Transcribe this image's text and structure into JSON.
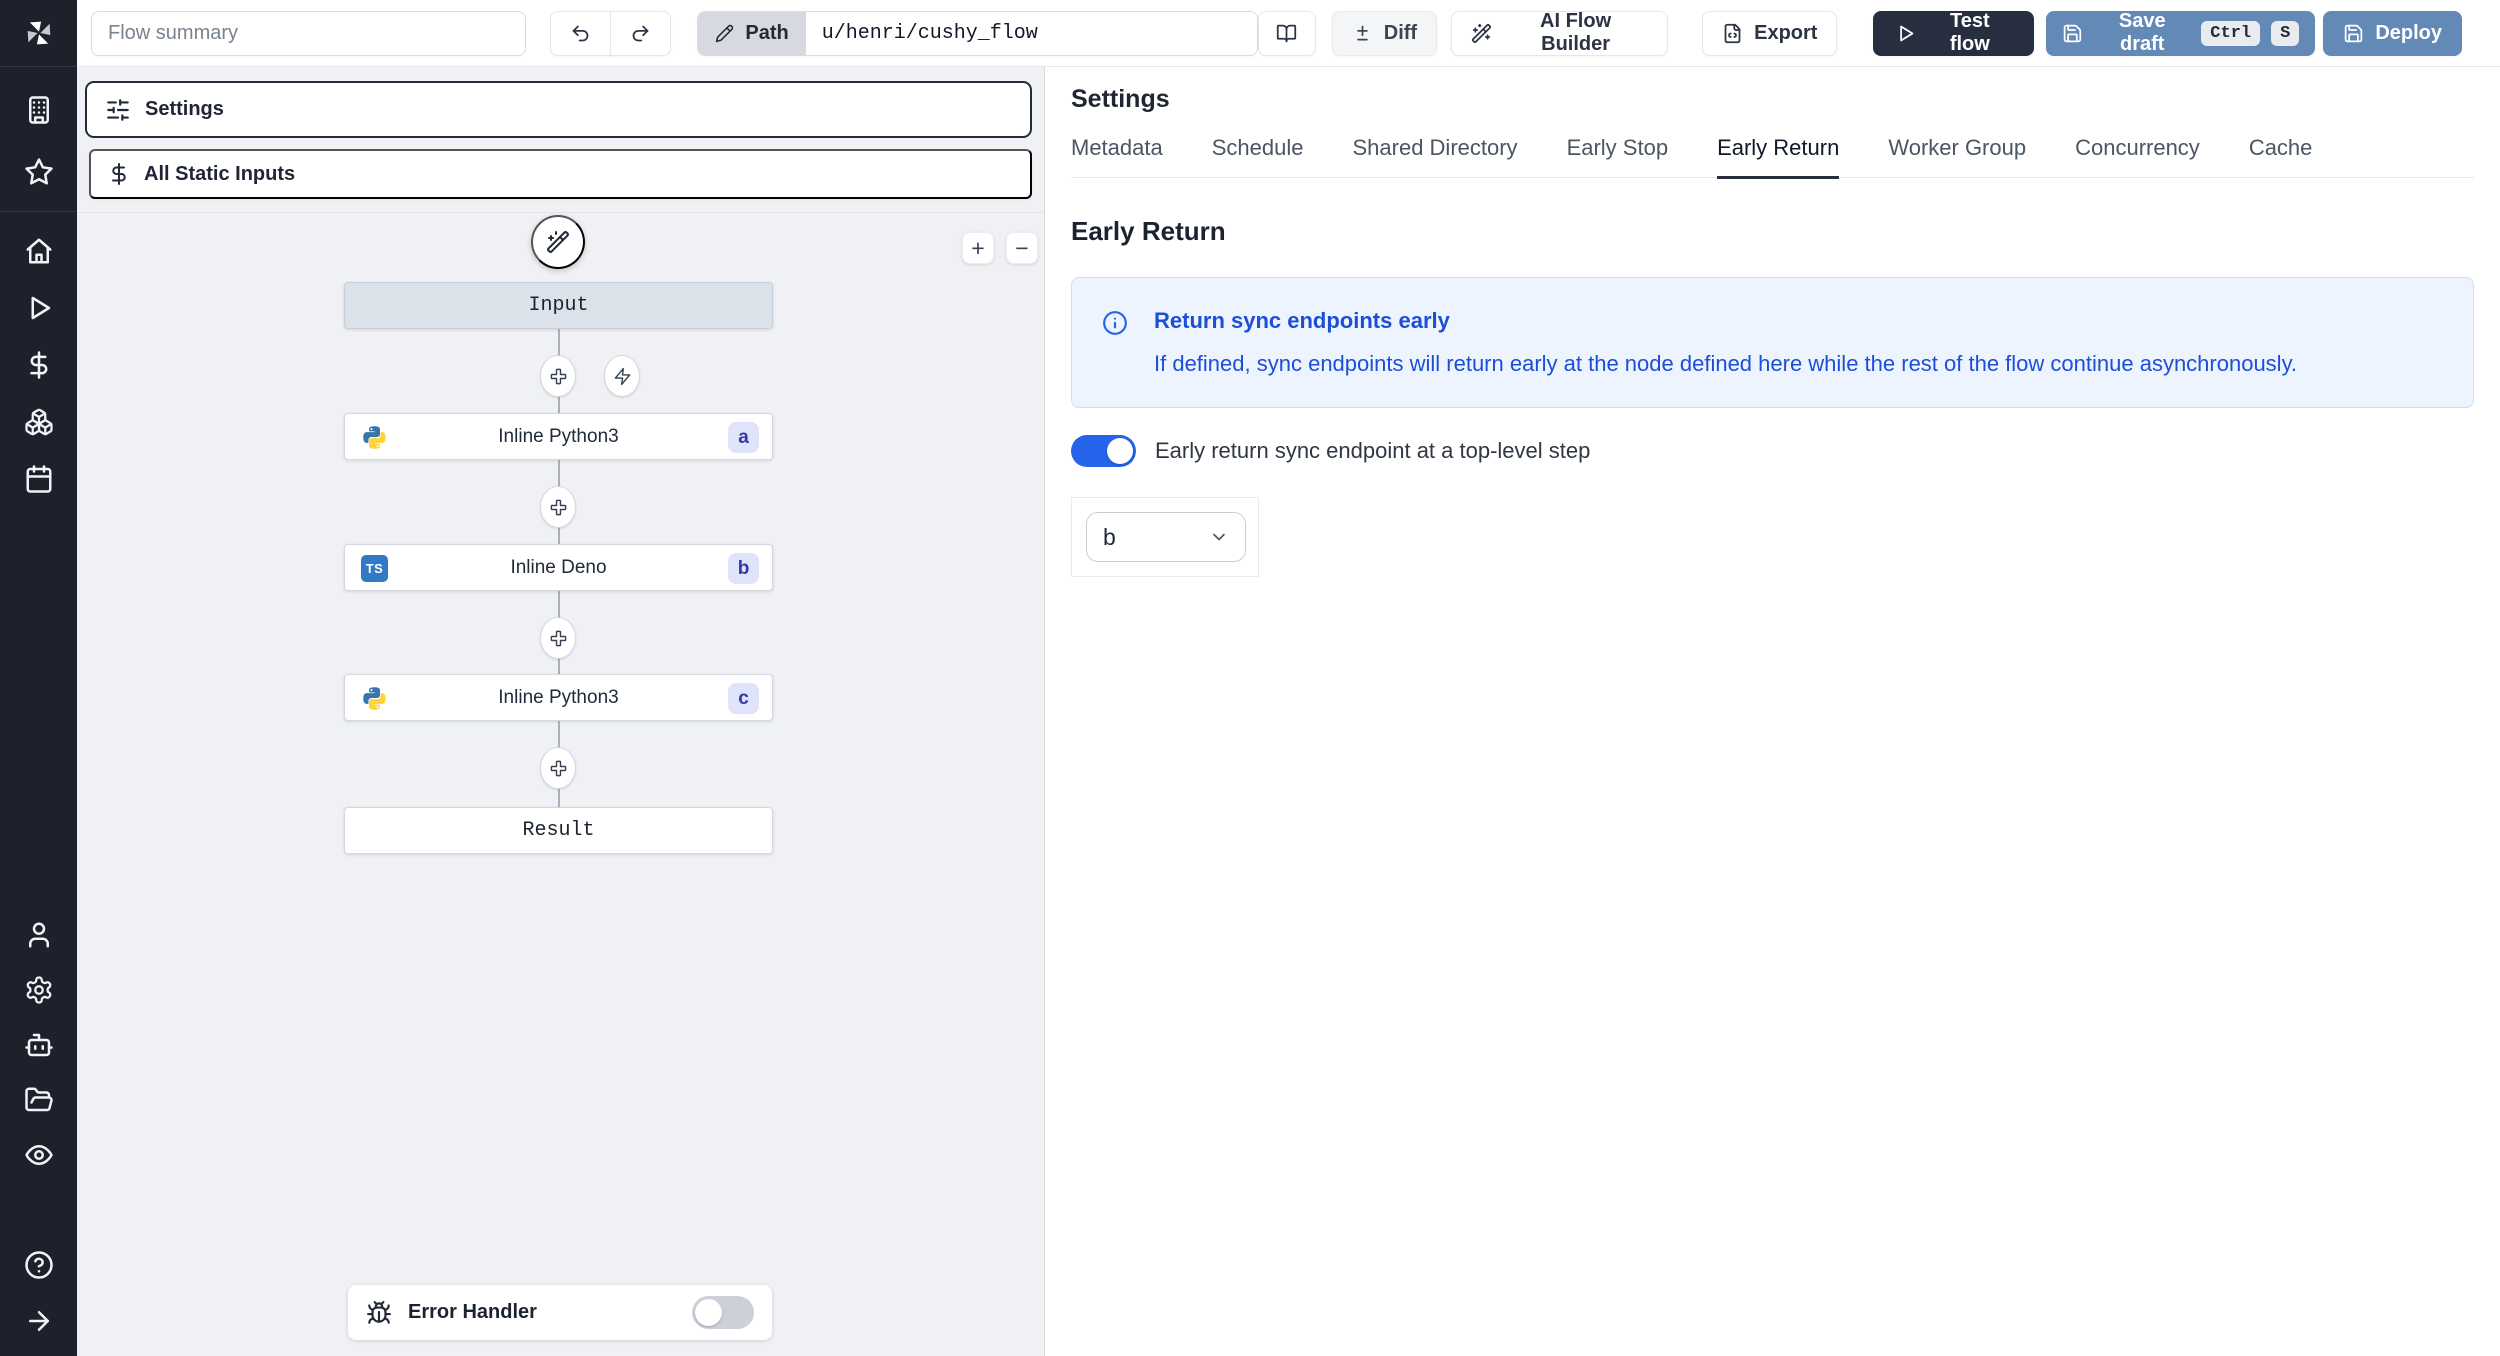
{
  "topbar": {
    "flow_summary_placeholder": "Flow summary",
    "path_label": "Path",
    "path_value": "u/henri/cushy_flow",
    "buttons": {
      "diff": "Diff",
      "ai_flow_builder": "AI Flow Builder",
      "export": "Export",
      "test_flow": "Test flow",
      "save_draft": "Save draft",
      "deploy": "Deploy"
    },
    "kbd": {
      "ctrl": "Ctrl",
      "s": "S"
    }
  },
  "sidebar": {
    "icons": [
      "windmill-logo",
      "building",
      "star",
      "home",
      "play",
      "dollar",
      "boxes",
      "calendar",
      "user",
      "gear",
      "robot",
      "folder-open",
      "eye",
      "help-circle",
      "arrow-right"
    ]
  },
  "flow_panel": {
    "settings_label": "Settings",
    "all_static_inputs_label": "All Static Inputs",
    "zoom_in_label": "+",
    "zoom_out_label": "−",
    "input_node_label": "Input",
    "steps": [
      {
        "label": "Inline Python3",
        "badge": "a",
        "language": "python"
      },
      {
        "label": "Inline Deno",
        "badge": "b",
        "language": "typescript"
      },
      {
        "label": "Inline Python3",
        "badge": "c",
        "language": "python"
      }
    ],
    "ts_icon_text": "TS",
    "result_node_label": "Result",
    "error_handler_label": "Error Handler",
    "error_handler_enabled": false
  },
  "right_panel": {
    "title": "Settings",
    "tabs": [
      "Metadata",
      "Schedule",
      "Shared Directory",
      "Early Stop",
      "Early Return",
      "Worker Group",
      "Concurrency",
      "Cache"
    ],
    "active_tab": "Early Return",
    "section_title": "Early Return",
    "info_title": "Return sync endpoints early",
    "info_body": "If defined, sync endpoints will return early at the node defined here while the rest of the flow continue asynchronously.",
    "toggle_label": "Early return sync endpoint at a top-level step",
    "toggle_on": true,
    "select_value": "b"
  },
  "colors": {
    "sidebar_bg": "#1d212c",
    "canvas_bg": "#eff1f4",
    "accent_blue": "#2563eb",
    "steel_blue_button": "#6389b6",
    "dark_button": "#272e40",
    "info_bg": "#edf4fe",
    "info_text": "#1d4ed8",
    "badge_bg": "#dfe4fb",
    "badge_text": "#3538a8",
    "input_node_bg": "#dbe2ea",
    "ts_blue": "#3178c6"
  }
}
